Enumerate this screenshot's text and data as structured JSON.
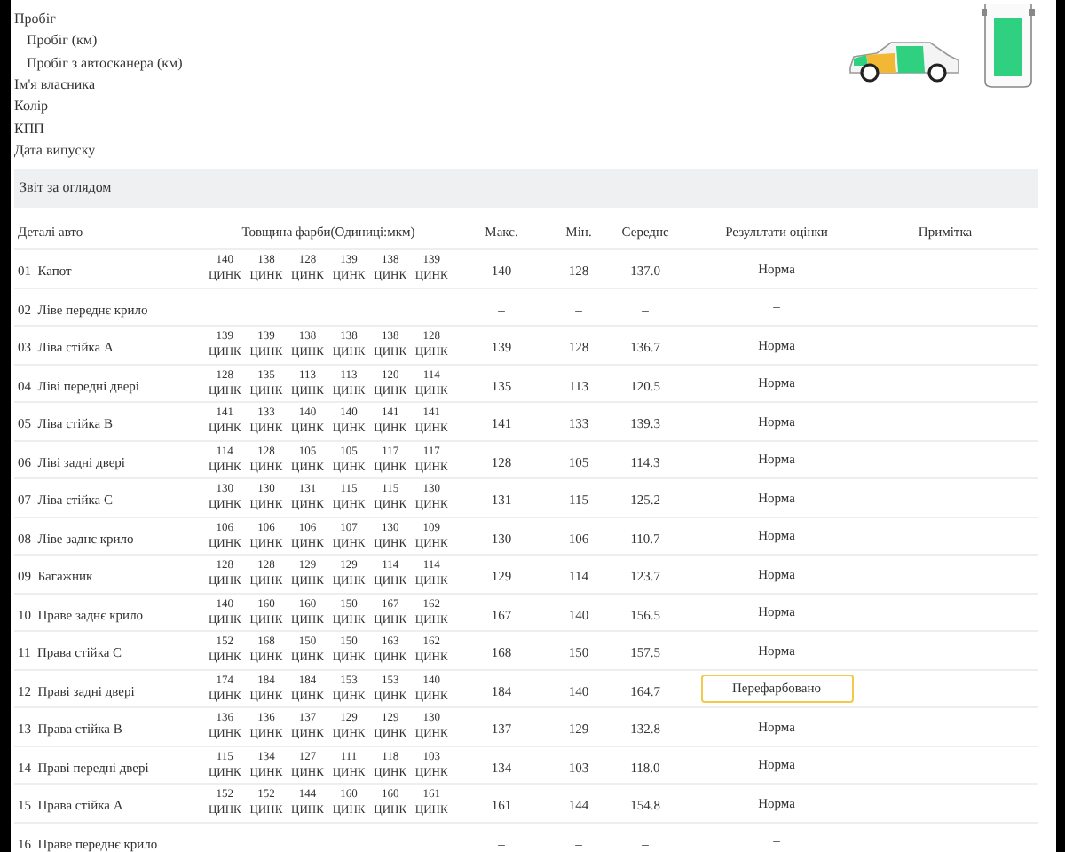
{
  "info_rows": [
    {
      "label": "Пробіг",
      "children": [
        {
          "label": "Пробіг (км)"
        },
        {
          "label": "Пробіг з автосканера (км)"
        }
      ]
    },
    {
      "label": "Ім'я власника"
    },
    {
      "label": "Колір"
    },
    {
      "label": "КПП"
    },
    {
      "label": "Дата випуску"
    }
  ],
  "section_title": "Звіт за оглядом",
  "table": {
    "columns": [
      "Деталі авто",
      "Товщина фарби(Одиниці:мкм)",
      "Макс.",
      "Мін.",
      "Середнє",
      "Результати оцінки",
      "Примітка"
    ],
    "rows": [
      {
        "part": "01  Капот",
        "readings": [
          [
            "140",
            "ЦИНК"
          ],
          [
            "138",
            "ЦИНК"
          ],
          [
            "128",
            "ЦИНК"
          ],
          [
            "139",
            "ЦИНК"
          ],
          [
            "138",
            "ЦИНК"
          ],
          [
            "139",
            "ЦИНК"
          ]
        ],
        "max": "140",
        "min": "128",
        "avg": "137.0",
        "result": "Норма",
        "flagged": false
      },
      {
        "part": "02  Ліве переднє крило",
        "readings": [],
        "max": "–",
        "min": "–",
        "avg": "–",
        "result": "–",
        "flagged": false
      },
      {
        "part": "03  Ліва стійка A",
        "readings": [
          [
            "139",
            "ЦИНК"
          ],
          [
            "139",
            "ЦИНК"
          ],
          [
            "138",
            "ЦИНК"
          ],
          [
            "138",
            "ЦИНК"
          ],
          [
            "138",
            "ЦИНК"
          ],
          [
            "128",
            "ЦИНК"
          ]
        ],
        "max": "139",
        "min": "128",
        "avg": "136.7",
        "result": "Норма",
        "flagged": false
      },
      {
        "part": "04  Ліві передні двері",
        "readings": [
          [
            "128",
            "ЦИНК"
          ],
          [
            "135",
            "ЦИНК"
          ],
          [
            "113",
            "ЦИНК"
          ],
          [
            "113",
            "ЦИНК"
          ],
          [
            "120",
            "ЦИНК"
          ],
          [
            "114",
            "ЦИНК"
          ]
        ],
        "max": "135",
        "min": "113",
        "avg": "120.5",
        "result": "Норма",
        "flagged": false
      },
      {
        "part": "05  Ліва стійка B",
        "readings": [
          [
            "141",
            "ЦИНК"
          ],
          [
            "133",
            "ЦИНК"
          ],
          [
            "140",
            "ЦИНК"
          ],
          [
            "140",
            "ЦИНК"
          ],
          [
            "141",
            "ЦИНК"
          ],
          [
            "141",
            "ЦИНК"
          ]
        ],
        "max": "141",
        "min": "133",
        "avg": "139.3",
        "result": "Норма",
        "flagged": false
      },
      {
        "part": "06  Ліві задні двері",
        "readings": [
          [
            "114",
            "ЦИНК"
          ],
          [
            "128",
            "ЦИНК"
          ],
          [
            "105",
            "ЦИНК"
          ],
          [
            "105",
            "ЦИНК"
          ],
          [
            "117",
            "ЦИНК"
          ],
          [
            "117",
            "ЦИНК"
          ]
        ],
        "max": "128",
        "min": "105",
        "avg": "114.3",
        "result": "Норма",
        "flagged": false
      },
      {
        "part": "07  Ліва стійка C",
        "readings": [
          [
            "130",
            "ЦИНК"
          ],
          [
            "130",
            "ЦИНК"
          ],
          [
            "131",
            "ЦИНК"
          ],
          [
            "115",
            "ЦИНК"
          ],
          [
            "115",
            "ЦИНК"
          ],
          [
            "130",
            "ЦИНК"
          ]
        ],
        "max": "131",
        "min": "115",
        "avg": "125.2",
        "result": "Норма",
        "flagged": false
      },
      {
        "part": "08  Ліве заднє крило",
        "readings": [
          [
            "106",
            "ЦИНК"
          ],
          [
            "106",
            "ЦИНК"
          ],
          [
            "106",
            "ЦИНК"
          ],
          [
            "107",
            "ЦИНК"
          ],
          [
            "130",
            "ЦИНК"
          ],
          [
            "109",
            "ЦИНК"
          ]
        ],
        "max": "130",
        "min": "106",
        "avg": "110.7",
        "result": "Норма",
        "flagged": false
      },
      {
        "part": "09  Багажник",
        "readings": [
          [
            "128",
            "ЦИНК"
          ],
          [
            "128",
            "ЦИНК"
          ],
          [
            "129",
            "ЦИНК"
          ],
          [
            "129",
            "ЦИНК"
          ],
          [
            "114",
            "ЦИНК"
          ],
          [
            "114",
            "ЦИНК"
          ]
        ],
        "max": "129",
        "min": "114",
        "avg": "123.7",
        "result": "Норма",
        "flagged": false
      },
      {
        "part": "10  Праве заднє крило",
        "readings": [
          [
            "140",
            "ЦИНК"
          ],
          [
            "160",
            "ЦИНК"
          ],
          [
            "160",
            "ЦИНК"
          ],
          [
            "150",
            "ЦИНК"
          ],
          [
            "167",
            "ЦИНК"
          ],
          [
            "162",
            "ЦИНК"
          ]
        ],
        "max": "167",
        "min": "140",
        "avg": "156.5",
        "result": "Норма",
        "flagged": false
      },
      {
        "part": "11  Права стійка C",
        "readings": [
          [
            "152",
            "ЦИНК"
          ],
          [
            "168",
            "ЦИНК"
          ],
          [
            "150",
            "ЦИНК"
          ],
          [
            "150",
            "ЦИНК"
          ],
          [
            "163",
            "ЦИНК"
          ],
          [
            "162",
            "ЦИНК"
          ]
        ],
        "max": "168",
        "min": "150",
        "avg": "157.5",
        "result": "Норма",
        "flagged": false
      },
      {
        "part": "12  Праві задні двері",
        "readings": [
          [
            "174",
            "ЦИНК"
          ],
          [
            "184",
            "ЦИНК"
          ],
          [
            "184",
            "ЦИНК"
          ],
          [
            "153",
            "ЦИНК"
          ],
          [
            "153",
            "ЦИНК"
          ],
          [
            "140",
            "ЦИНК"
          ]
        ],
        "max": "184",
        "min": "140",
        "avg": "164.7",
        "result": "Перефарбовано",
        "flagged": true
      },
      {
        "part": "13  Права стійка B",
        "readings": [
          [
            "136",
            "ЦИНК"
          ],
          [
            "136",
            "ЦИНК"
          ],
          [
            "137",
            "ЦИНК"
          ],
          [
            "129",
            "ЦИНК"
          ],
          [
            "129",
            "ЦИНК"
          ],
          [
            "130",
            "ЦИНК"
          ]
        ],
        "max": "137",
        "min": "129",
        "avg": "132.8",
        "result": "Норма",
        "flagged": false
      },
      {
        "part": "14  Праві передні двері",
        "readings": [
          [
            "115",
            "ЦИНК"
          ],
          [
            "134",
            "ЦИНК"
          ],
          [
            "127",
            "ЦИНК"
          ],
          [
            "111",
            "ЦИНК"
          ],
          [
            "118",
            "ЦИНК"
          ],
          [
            "103",
            "ЦИНК"
          ]
        ],
        "max": "134",
        "min": "103",
        "avg": "118.0",
        "result": "Норма",
        "flagged": false
      },
      {
        "part": "15  Права стійка A",
        "readings": [
          [
            "152",
            "ЦИНК"
          ],
          [
            "152",
            "ЦИНК"
          ],
          [
            "144",
            "ЦИНК"
          ],
          [
            "160",
            "ЦИНК"
          ],
          [
            "160",
            "ЦИНК"
          ],
          [
            "161",
            "ЦИНК"
          ]
        ],
        "max": "161",
        "min": "144",
        "avg": "154.8",
        "result": "Норма",
        "flagged": false
      },
      {
        "part": "16  Праве переднє крило",
        "readings": [],
        "max": "–",
        "min": "–",
        "avg": "–",
        "result": "–",
        "flagged": false
      }
    ]
  }
}
